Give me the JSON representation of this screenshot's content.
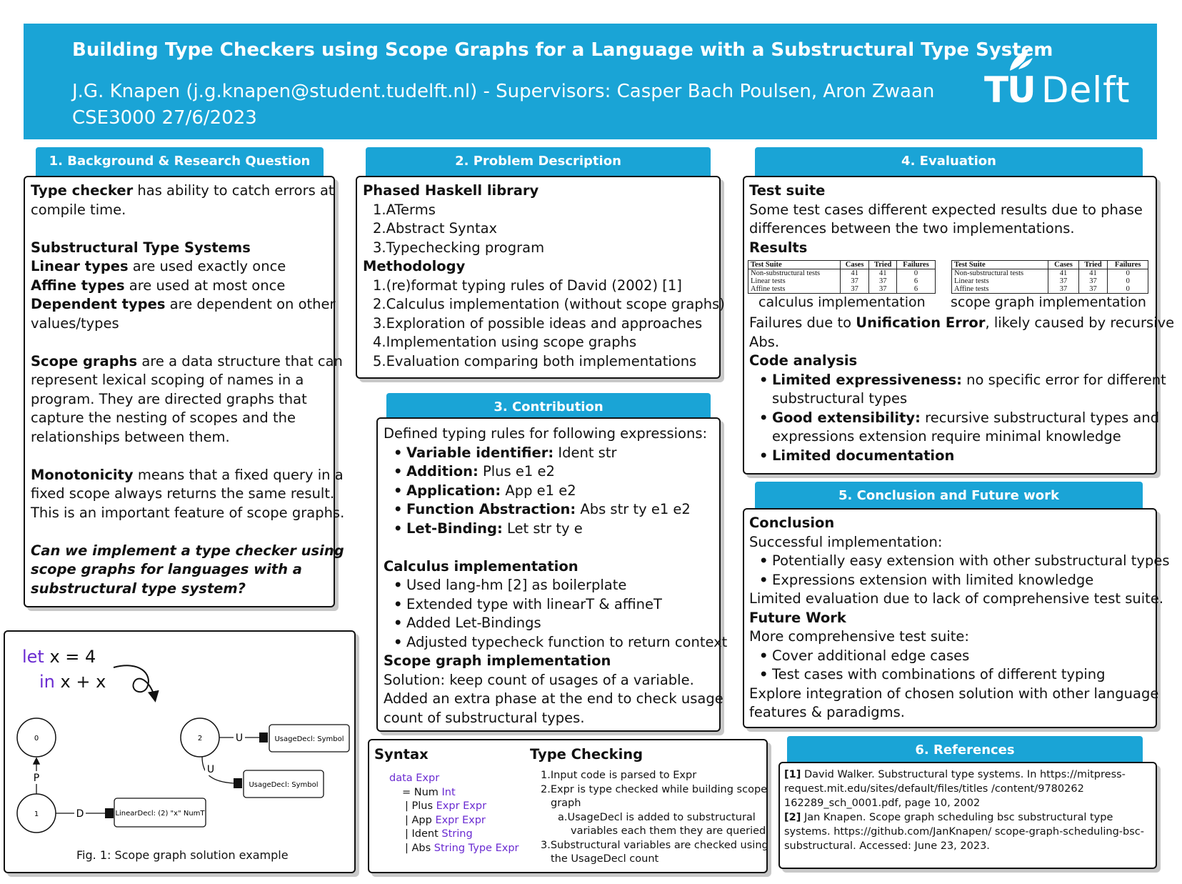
{
  "header": {
    "title": "Building Type Checkers using Scope Graphs for a Language with a Substructural Type System",
    "authors": "J.G. Knapen (j.g.knapen@student.tudelft.nl) - Supervisors: Casper Bach Poulsen, Aron Zwaan",
    "course": "CSE3000 27/6/2023",
    "logo": {
      "tu": "TU",
      "delft": "Delft"
    }
  },
  "colors": {
    "accent": "#1aa4d6",
    "keyword": "#6a2bd1"
  },
  "background": {
    "heading": "1. Background & Research Question",
    "p1_bold": "Type checker",
    "p1_rest": " has ability to catch errors at",
    "p1_line2": "compile time.",
    "subhead": "Substructural Type Systems",
    "linear_bold": "Linear types",
    "linear_rest": " are used exactly once",
    "affine_bold": "Affine types",
    "affine_rest": " are used at most once",
    "dep_bold": "Dependent types",
    "dep_rest": " are dependent on other",
    "dep_line2": "values/types",
    "scope_bold": "Scope graphs",
    "scope_rest": " are a data structure that can",
    "scope_l2": "represent lexical scoping of names in a",
    "scope_l3": "program. They are directed graphs that",
    "scope_l4": "capture the nesting of scopes and the",
    "scope_l5": "relationships between them.",
    "mono_bold": "Monotonicity",
    "mono_rest": " means that a fixed query in a",
    "mono_l2": "fixed scope always returns the same result.",
    "mono_l3": "This is an important feature of scope graphs.",
    "rq_l1": "Can we implement a type checker using",
    "rq_l2": "scope graphs for languages with a",
    "rq_l3": "substructural type system?"
  },
  "figure": {
    "code_let": "let",
    "code_line1": " x = 4",
    "code_in": "in",
    "code_line2": " x + x",
    "node0": "0",
    "node1": "1",
    "node2": "2",
    "edge_p": "P",
    "edge_d": "D",
    "edge_u1": "U",
    "edge_u2": "U",
    "decl_usage1": "UsageDecl: Symbol",
    "decl_usage2": "UsageDecl: Symbol",
    "decl_linear": "LinearDecl: (2) \"x\" NumT",
    "caption": "Fig. 1: Scope graph solution example"
  },
  "problem": {
    "heading": "2. Problem Description",
    "lib_head": "Phased Haskell library",
    "lib_items": [
      "ATerms",
      "Abstract Syntax",
      "Typechecking program"
    ],
    "meth_head": "Methodology",
    "meth_items": [
      "(re)format typing rules of David (2002) [1]",
      "Calculus implementation (without scope graphs)",
      "Exploration of possible ideas and approaches",
      "Implementation using scope graphs",
      "Evaluation comparing both implementations"
    ]
  },
  "contribution": {
    "heading": "3. Contribution",
    "intro": "Defined typing rules for following expressions:",
    "rules": [
      {
        "b": "Variable identifier:",
        "t": " Ident str"
      },
      {
        "b": "Addition:",
        "t": " Plus e1 e2"
      },
      {
        "b": "Application:",
        "t": " App e1 e2"
      },
      {
        "b": "Function Abstraction:",
        "t": " Abs str ty e1 e2"
      },
      {
        "b": "Let-Binding:",
        "t": " Let str ty e"
      }
    ],
    "calc_head": "Calculus implementation",
    "calc_items": [
      "Used lang-hm [2] as boilerplate",
      "Extended type with linearT & affineT",
      "Added Let-Bindings",
      "Adjusted typecheck function to return context"
    ],
    "sg_head": "Scope graph implementation",
    "sg_l1": "Solution: keep count of usages of a variable.",
    "sg_l2": "Added an extra phase at the end to check usage",
    "sg_l3": "count of substructural types."
  },
  "syntax": {
    "heading": "Syntax",
    "data_kw": "data Expr",
    "lines": [
      {
        "pre": "= Num ",
        "kw": "Int"
      },
      {
        "pre": "| Plus ",
        "kw": "Expr Expr"
      },
      {
        "pre": "| App ",
        "kw": "Expr Expr"
      },
      {
        "pre": "| Ident ",
        "kw": "String"
      },
      {
        "pre": "| Abs ",
        "kw": "String Type Expr"
      }
    ]
  },
  "typechecking": {
    "heading": "Type Checking",
    "s1": "Input code is parsed to Expr",
    "s2a": "Expr is type checked while building scope",
    "s2b": "graph",
    "s2sub_a": "UsageDecl is added to substructural",
    "s2sub_b": "variables each them they are queried",
    "s3a": "Substructural variables are checked using",
    "s3b": "the UsageDecl count",
    "n1": "1.",
    "n2": "2.",
    "na": "a.",
    "n3": "3."
  },
  "evaluation": {
    "heading": "4. Evaluation",
    "suite_head": "Test suite",
    "suite_l1": "Some test cases different expected results due to phase",
    "suite_l2": "differences between the two implementations.",
    "results_head": "Results",
    "table_headers": [
      "Test Suite",
      "Cases",
      "Tried",
      "Failures"
    ],
    "table_calc": [
      [
        "Non-substructural tests",
        "41",
        "41",
        "0"
      ],
      [
        "Linear tests",
        "37",
        "37",
        "6"
      ],
      [
        "Affine tests",
        "37",
        "37",
        "6"
      ]
    ],
    "table_sg": [
      [
        "Non-substructural tests",
        "41",
        "41",
        "0"
      ],
      [
        "Linear tests",
        "37",
        "37",
        "0"
      ],
      [
        "Affine tests",
        "37",
        "37",
        "0"
      ]
    ],
    "caption_calc": "calculus implementation",
    "caption_sg": "scope graph implementation",
    "fail_pre": "Failures due to ",
    "fail_bold": "Unification Error",
    "fail_rest": ", likely caused by recursive",
    "fail_l2": "Abs.",
    "code_head": "Code analysis",
    "ca1_b": "Limited expressiveness:",
    "ca1_t": " no specific error for different",
    "ca1_l2": "substructural types",
    "ca2_b": "Good extensibility:",
    "ca2_t": " recursive substructural types and",
    "ca2_l2": "expressions extension require minimal knowledge",
    "ca3_b": "Limited documentation"
  },
  "conclusion": {
    "heading": "5. Conclusion and Future work",
    "c_head": "Conclusion",
    "c_l1": "Successful implementation:",
    "c_items": [
      "Potentially easy extension with other substructural types",
      "Expressions extension with limited knowledge"
    ],
    "c_l2": "Limited evaluation due to lack of comprehensive test suite.",
    "fw_head": "Future Work",
    "fw_l1": "More comprehensive test suite:",
    "fw_items": [
      "Cover additional edge cases",
      "Test cases with combinations of different typing"
    ],
    "fw_l2": "Explore integration of chosen solution with other language",
    "fw_l3": "features & paradigms."
  },
  "references": {
    "heading": "6. References",
    "r1_tag": "[1]",
    "r1_l1": " David Walker. Substructural type systems. In https://mitpress-",
    "r1_l2": "request.mit.edu/sites/default/files/titles /content/9780262",
    "r1_l3": "162289_sch_0001.pdf, page 10, 2002",
    "r2_tag": "[2]",
    "r2_l1": " Jan Knapen. Scope graph scheduling bsc substructural type",
    "r2_l2": "systems. https://github.com/JanKnapen/ scope-graph-scheduling-bsc-",
    "r2_l3": "substructural. Accessed: June 23, 2023."
  }
}
